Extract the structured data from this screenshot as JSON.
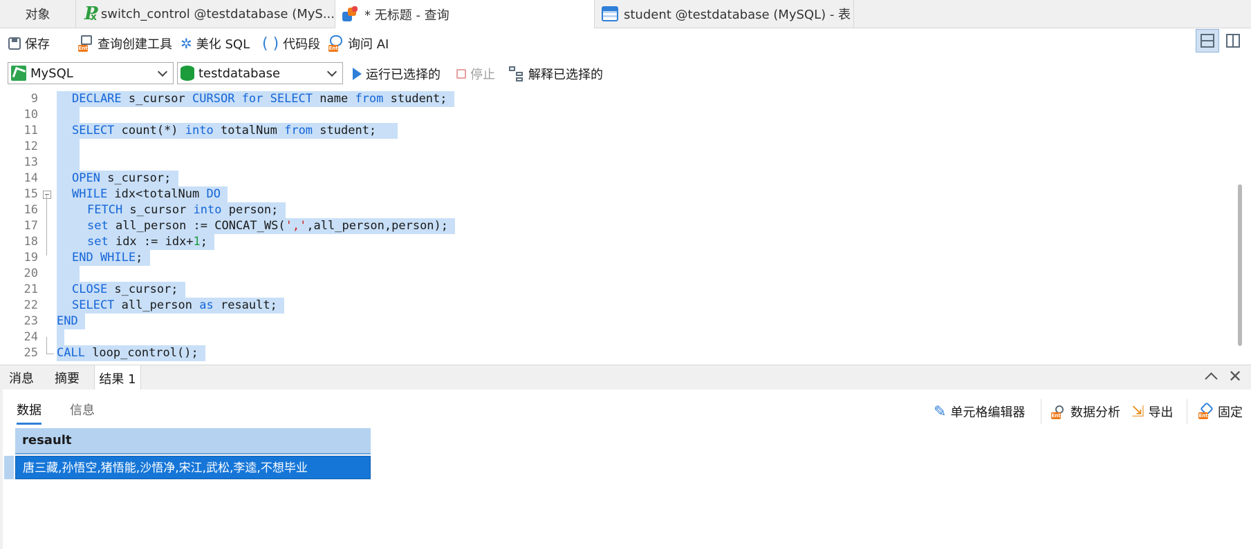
{
  "tabs": [
    {
      "label": "对象"
    },
    {
      "label": "switch_control @testdatabase (MyS..."
    },
    {
      "label": "* 无标题 - 查询"
    },
    {
      "label": "student @testdatabase (MySQL) - 表"
    }
  ],
  "toolbar": {
    "save": "保存",
    "query_builder": "查询创建工具",
    "beautify": "美化 SQL",
    "snippet": "代码段",
    "ask_ai": "询问 AI"
  },
  "connection": {
    "type": "MySQL",
    "database": "testdatabase"
  },
  "run_bar": {
    "run_selected": "运行已选择的",
    "stop": "停止",
    "explain_selected": "解释已选择的"
  },
  "editor": {
    "lines": [
      {
        "n": "9"
      },
      {
        "n": "10"
      },
      {
        "n": "11"
      },
      {
        "n": "12"
      },
      {
        "n": "13"
      },
      {
        "n": "14"
      },
      {
        "n": "15"
      },
      {
        "n": "16"
      },
      {
        "n": "17"
      },
      {
        "n": "18"
      },
      {
        "n": "19"
      },
      {
        "n": "20"
      },
      {
        "n": "21"
      },
      {
        "n": "22"
      },
      {
        "n": "23"
      },
      {
        "n": "24"
      },
      {
        "n": "25"
      }
    ],
    "code": {
      "l9": {
        "kw1": "DECLARE",
        "t1": " s_cursor ",
        "kw2": "CURSOR for SELECT",
        "t2": " name ",
        "kw3": "from",
        "t3": " student;"
      },
      "l11": {
        "kw1": "SELECT",
        "t1": " count(*) ",
        "kw2": "into",
        "t2": " totalNum ",
        "kw3": "from",
        "t3": " student;"
      },
      "l14": {
        "kw1": "OPEN",
        "t1": " s_cursor;"
      },
      "l15": {
        "kw1": "WHILE",
        "t1": " idx<totalNum ",
        "kw2": "DO"
      },
      "l16": {
        "kw1": "FETCH",
        "t1": " s_cursor ",
        "kw2": "into",
        "t2": " person;"
      },
      "l17": {
        "kw1": "set",
        "t1": " all_person := CONCAT_WS(",
        "s1": "','",
        "t2": ",all_person,person);"
      },
      "l18": {
        "kw1": "set",
        "t1": " idx := idx+",
        "n1": "1",
        "t2": ";"
      },
      "l19": {
        "kw1": "END WHILE",
        "t1": ";"
      },
      "l21": {
        "kw1": "CLOSE",
        "t1": " s_cursor;"
      },
      "l22": {
        "kw1": "SELECT",
        "t1": " all_person ",
        "kw2": "as",
        "t2": " resault;"
      },
      "l23": {
        "kw1": "END"
      },
      "l25": {
        "kw1": "CALL",
        "t1": " loop_control();"
      }
    }
  },
  "result_tabs": [
    "消息",
    "摘要",
    "结果 1"
  ],
  "sub_tabs": [
    "数据",
    "信息"
  ],
  "result_tools": {
    "cell_editor": "单元格编辑器",
    "analysis": "数据分析",
    "export": "导出",
    "pin": "固定"
  },
  "grid": {
    "column": "resault",
    "value": "唐三藏,孙悟空,猪悟能,沙悟净,宋江,武松,李逵,不想毕业"
  },
  "colors": {
    "selection": "#c8dff7",
    "keyword": "#1565d8",
    "accent": "#2f7fd8",
    "row_selected": "#1676d8"
  }
}
